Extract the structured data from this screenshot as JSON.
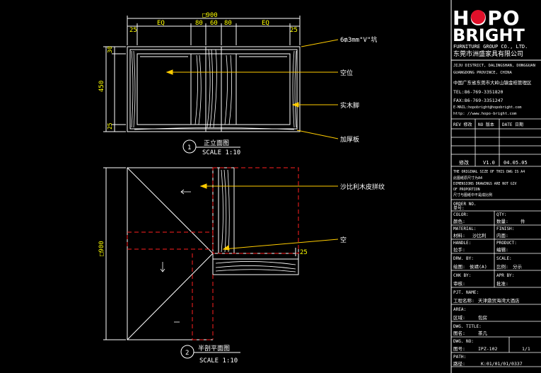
{
  "dims": {
    "total_width": "□900",
    "segments": [
      "25",
      "EQ",
      "80",
      "60",
      "80",
      "EQ",
      "25"
    ],
    "height_total": "450",
    "height_top": "30",
    "height_bottom": "25",
    "plan_height": "□900",
    "plan_offset": "25"
  },
  "callouts": {
    "c1": "6₥3mm\"V\"坑",
    "c2": "空位",
    "c3": "实木脚",
    "c4": "加厚板",
    "c5": "沙比利木皮拼纹",
    "c6": "空"
  },
  "views": {
    "front": {
      "num": "1",
      "title": "正立面图",
      "scale": "SCALE 1:10"
    },
    "plan": {
      "num": "2",
      "title": "半剖平面图",
      "scale": "SCALE 1:10"
    }
  },
  "brand": {
    "logo_line1": "HOPO",
    "logo_line2": "BRIGHT",
    "sub_en": "FURNITURE GROUP CO., LTD.",
    "sub_cn": "东莞市洲盛家具有限公司",
    "addr1": "JIJU DISTRICT, DALINGSHAN, DONGGUAN",
    "addr2": "GUANGDONG PROVINCE, CHINA",
    "addr3": "中国广东省东莞市大岭山镇金桔管理区",
    "tel": "TEL:86-769-3351820",
    "fax": "FAX:86-769-3351247",
    "email": "E-MAIL:hopobright@hopobright.com",
    "web": "http: //www.hopo-bright.com"
  },
  "revision": {
    "header": [
      "REV 修改",
      "NO 版本",
      "DATE 日期"
    ],
    "row": [
      "修改",
      "V1.0",
      "04.05.05"
    ]
  },
  "notes": [
    "THE ORIGINAL SIZE OF THIS DWG IS A4",
    "此图纸原尺寸为A4",
    "DIMENSIONS DRAWINGS ARE NOT GIV",
    "OF PROPORTION",
    "尺寸与图纸中不是成比例"
  ],
  "spec": {
    "order_no": "ORDER NO.",
    "item_no": "单号:",
    "color_label": "COLOR:",
    "qty_label": "QTY:",
    "color_cn": "颜色:",
    "qty_cn": "数量:",
    "qty_unit": "件",
    "material_label": "MATERIAL:",
    "finish_label": "FINISH:",
    "material_cn": "材料:",
    "material_val": "沙比利",
    "finish_cn": "内面:",
    "handle_label": "HANDLE:",
    "product_label": "PRODUCT:",
    "handle_cn": "拉手:",
    "product_cn": "编辑:",
    "drw_by": "DRW. BY:",
    "scale_label": "SCALE:",
    "drw_cn": "绘图:",
    "drw_val": "侯靖(A)",
    "scale_cn": "比例:",
    "scale_val": "分示",
    "chk_by": "CHK BY:",
    "apr_by": "APR BY:",
    "chk_cn": "审核:",
    "apr_cn": "批准:",
    "pjt_name": "PJT. NAME:",
    "project_cn": "工程名称:",
    "project_val": "天津鼎贸海湾大酒店",
    "area_label": "AREA:",
    "area_cn": "区域:",
    "area_val": "包房",
    "dwg_title": "DWG. TITLE:",
    "name_cn": "图名:",
    "name_val": "茶几",
    "dwg_no": "DWG. NO:",
    "no_cn": "图号:",
    "no_val": "IPZ-102",
    "page_val": "1/1",
    "path_label": "PATH:",
    "path_cn": "路径:",
    "path_val": "K:01/01/01/0337"
  }
}
